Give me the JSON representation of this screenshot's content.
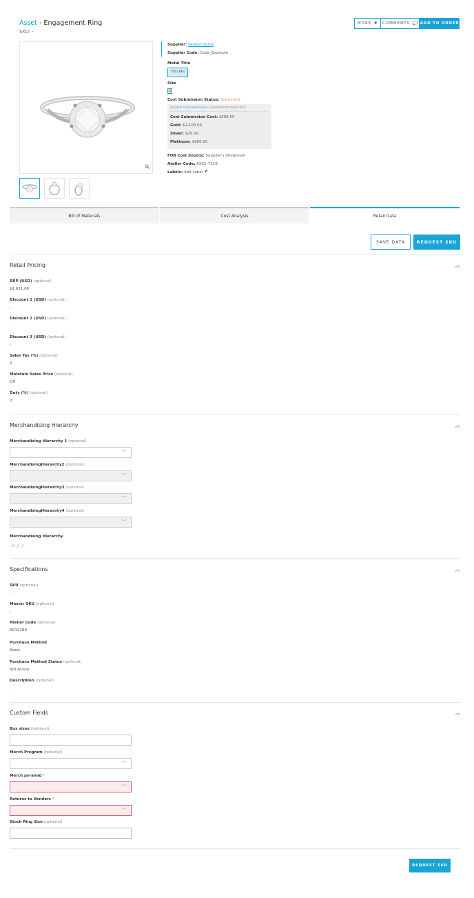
{
  "header": {
    "title_prefix": "Asset",
    "title_rest": " - Engagement Ring",
    "sku": "SKU: -"
  },
  "top_actions": {
    "more": "MORE",
    "comments": "COMMENTS",
    "add": "ADD TO ORDER"
  },
  "info": {
    "supplier_label": "Supplier:",
    "supplier_value": "Vendor Name",
    "supplier_code_label": "Supplier Code:",
    "supplier_code_value": "Code_Example",
    "metal_title_label": "Metal Title",
    "metal_chip": "750 (18k)",
    "size_label": "Size",
    "size_chip": "6",
    "cost_status_label": "Cost Submission Status:",
    "cost_status_value": "Submitted",
    "cost_box": {
      "link": "Current cost submission",
      "note": "Assortment metal lock",
      "rows": [
        {
          "label": "Cost Submission Cost:",
          "value": "$508.55"
        },
        {
          "label": "Gold:",
          "value": "$2,100.00"
        },
        {
          "label": "Silver:",
          "value": "$25.00"
        },
        {
          "label": "Platinum:",
          "value": "$900.00"
        }
      ]
    },
    "fob_label": "FOB Cost Source:",
    "fob_value": "Supplier's Showroom",
    "atelier_label": "Atelier Code:",
    "atelier_value": "AX21-7216",
    "labels_label": "Labels:",
    "labels_value": "Add Label"
  },
  "tabs": [
    "Bill of Materials",
    "Cost Analysis",
    "Retail Data"
  ],
  "actions": {
    "save": "SAVE DATA",
    "request": "REQUEST SKU"
  },
  "retail": {
    "title": "Retail Pricing",
    "optional": "(optional)",
    "fields": [
      {
        "label": "RRP (USD)",
        "value": "$1,631.06"
      },
      {
        "label": "Discount 1 (USD)",
        "value": "-"
      },
      {
        "label": "Discount 2 (USD)",
        "value": "-"
      },
      {
        "label": "Discount 3 (USD)",
        "value": "-"
      },
      {
        "label": "Sales Tax (%)",
        "value": "0"
      },
      {
        "label": "Maintain Sales Price",
        "value": "Off"
      },
      {
        "label": "Duty (%)",
        "value": "0"
      }
    ]
  },
  "merch": {
    "title": "Merchandising Hierarchy",
    "fields": [
      "Merchandising Hierarchy 1",
      "MerchandisingHierarchy2",
      "MerchandisingHierarchy3",
      "MerchandisingHierarchy4"
    ],
    "summary_label": "Merchandising Hierarchy",
    "summary_value": "- / - / - / -"
  },
  "specs": {
    "title": "Specifications",
    "fields": [
      {
        "label": "SKU",
        "optional": true,
        "value": "-"
      },
      {
        "label": "Master SKU",
        "optional": true,
        "value": "-"
      },
      {
        "label": "Atelier Code",
        "optional": true,
        "value": "AZ12288"
      },
      {
        "label": "Purchase Method",
        "optional": false,
        "value": "Asset"
      },
      {
        "label": "Purchase Method Status",
        "optional": true,
        "value": "Not Active"
      },
      {
        "label": "Description",
        "optional": true,
        "value": "-"
      }
    ]
  },
  "custom": {
    "title": "Custom Fields",
    "req": "*",
    "fields": [
      {
        "label": "Box sizes",
        "kind": "input",
        "optional": true
      },
      {
        "label": "Merch Program",
        "kind": "select",
        "optional": true
      },
      {
        "label": "Merch pyramid",
        "kind": "select-error",
        "optional": false
      },
      {
        "label": "Returns to Vendors",
        "kind": "select-error",
        "optional": false
      },
      {
        "label": "Stock Ring Size",
        "kind": "input",
        "optional": true
      }
    ]
  },
  "bottom": {
    "request": "REQUEST SKU"
  },
  "colors": {
    "accent": "#1aa4d6",
    "status": "#f0913a",
    "error": "#e0576d"
  }
}
